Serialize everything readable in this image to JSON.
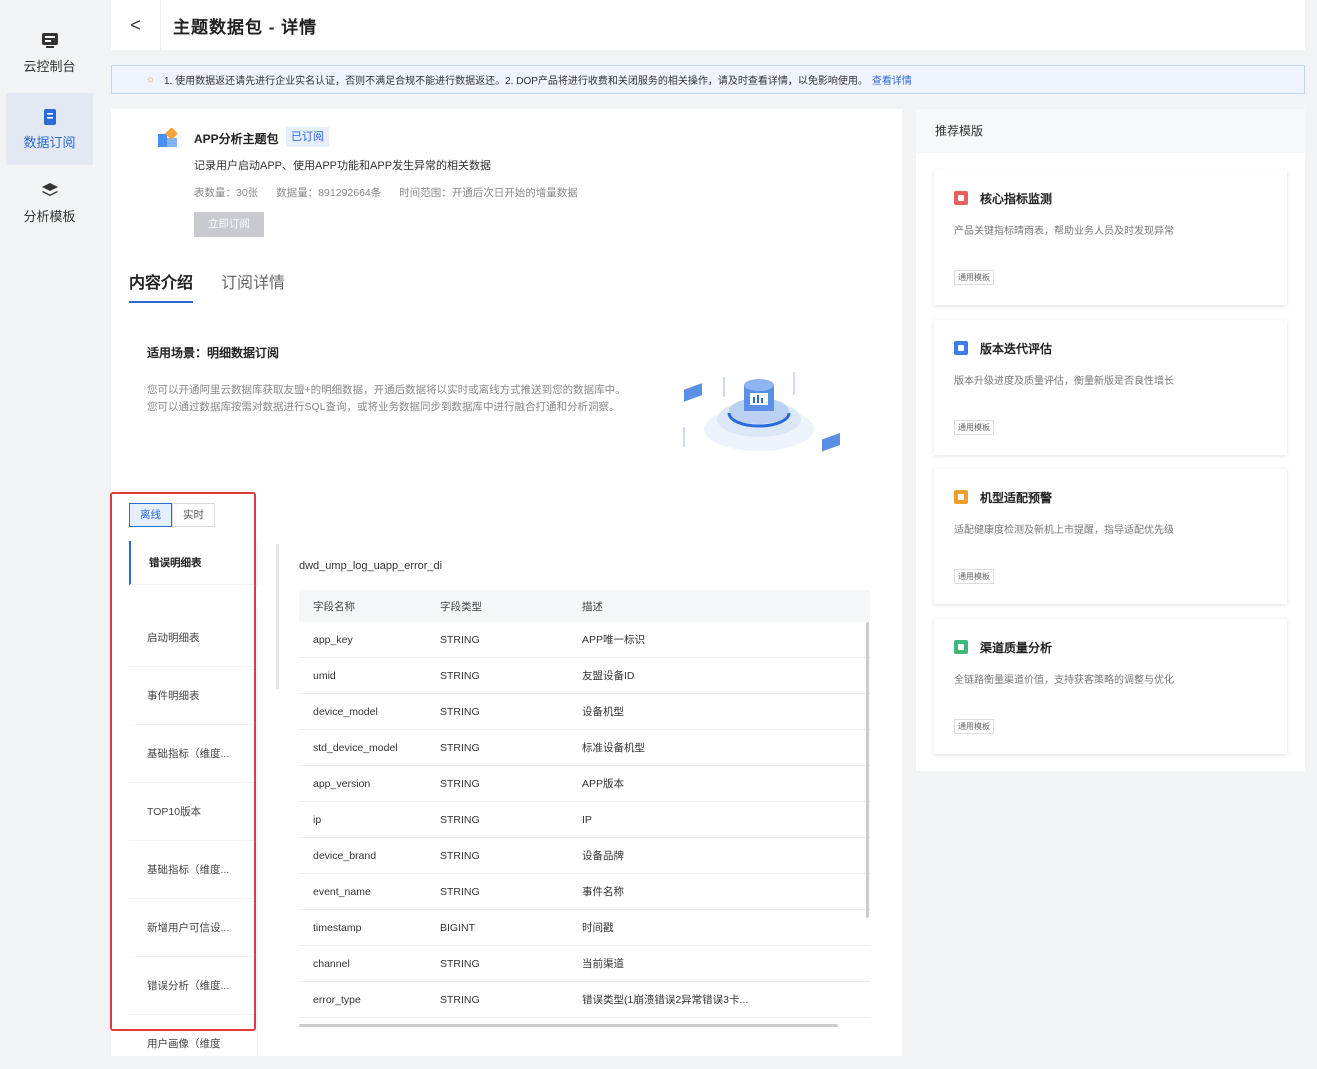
{
  "nav": {
    "items": [
      {
        "label": "云控制台",
        "icon": "monitor-icon"
      },
      {
        "label": "数据订阅",
        "icon": "document-icon"
      },
      {
        "label": "分析模板",
        "icon": "layers-icon"
      }
    ]
  },
  "header": {
    "title": "主题数据包 - 详情",
    "back_label": "<"
  },
  "notice": {
    "text": "1. 使用数据返还请先进行企业实名认证，否则不满足合规不能进行数据返还。2. DOP产品将进行收费和关闭服务的相关操作，请及时查看详情，以免影响使用。",
    "link": "查看详情"
  },
  "package": {
    "name": "APP分析主题包",
    "status": "已订阅",
    "desc": "记录用户启动APP、使用APP功能和APP发生异常的相关数据",
    "table_count": "表数量：30张",
    "data_count": "数据量：891292664条",
    "time_range": "时间范围：开通后次日开始的增量数据",
    "subscribe_button": "立即订阅"
  },
  "tabs": [
    "内容介绍",
    "订阅详情"
  ],
  "scene": {
    "title": "适用场景：明细数据订阅",
    "desc": "您可以开通阿里云数据库获取友盟+的明细数据，开通后数据将以实时或离线方式推送到您的数据库中。您可以通过数据库按需对数据进行SQL查询，或将业务数据同步到数据库中进行融合打通和分析洞察。"
  },
  "mode": {
    "offline": "离线",
    "realtime": "实时"
  },
  "table_list": [
    "错误明细表",
    "启动明细表",
    "事件明细表",
    "基础指标（维度...",
    "TOP10版本",
    "基础指标（维度...",
    "新增用户可信设...",
    "错误分析（维度...",
    "用户画像（维度"
  ],
  "table_name": "dwd_ump_log_uapp_error_di",
  "fields": {
    "headers": [
      "字段名称",
      "字段类型",
      "描述"
    ],
    "rows": [
      [
        "app_key",
        "STRING",
        "APP唯一标识"
      ],
      [
        "umid",
        "STRING",
        "友盟设备ID"
      ],
      [
        "device_model",
        "STRING",
        "设备机型"
      ],
      [
        "std_device_model",
        "STRING",
        "标准设备机型"
      ],
      [
        "app_version",
        "STRING",
        "APP版本"
      ],
      [
        "ip",
        "STRING",
        "IP"
      ],
      [
        "device_brand",
        "STRING",
        "设备品牌"
      ],
      [
        "event_name",
        "STRING",
        "事件名称"
      ],
      [
        "timestamp",
        "BIGINT",
        "时间戳"
      ],
      [
        "channel",
        "STRING",
        "当前渠道"
      ],
      [
        "error_type",
        "STRING",
        "错误类型(1崩溃错误2异常错误3卡..."
      ]
    ]
  },
  "recommend": {
    "title": "推荐模版",
    "cards": [
      {
        "title": "核心指标监测",
        "desc": "产品关键指标晴雨表，帮助业务人员及时发现异常",
        "badge": "通用模板",
        "color": "#e8605a"
      },
      {
        "title": "版本迭代评估",
        "desc": "版本升级进度及质量评估，衡量新版是否良性增长",
        "badge": "通用模板",
        "color": "#3d7be8"
      },
      {
        "title": "机型适配预警",
        "desc": "适配健康度检测及新机上市提醒，指导适配优先级",
        "badge": "通用模板",
        "color": "#f0a02a"
      },
      {
        "title": "渠道质量分析",
        "desc": "全链路衡量渠道价值，支持获客策略的调整与优化",
        "badge": "通用模板",
        "color": "#3fb67a"
      }
    ]
  },
  "colors": {
    "accent": "#2a6ad9",
    "highlight_box": "#e13c3c"
  }
}
